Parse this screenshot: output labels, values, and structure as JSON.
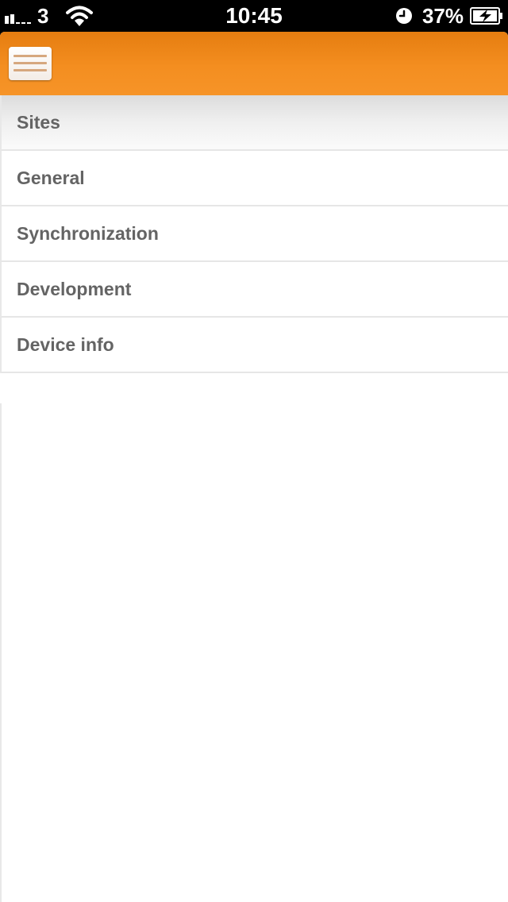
{
  "status_bar": {
    "carrier": "3",
    "time": "10:45",
    "battery_percent": "37%",
    "signal_icon": "signal-bars-icon",
    "wifi_icon": "wifi-icon",
    "alarm_icon": "alarm-clock-icon",
    "battery_icon": "battery-charging-icon"
  },
  "header": {
    "menu_icon": "hamburger-menu-icon",
    "color": "#f48e20"
  },
  "menu": {
    "items": [
      {
        "label": "Sites",
        "active": true
      },
      {
        "label": "General",
        "active": false
      },
      {
        "label": "Synchronization",
        "active": false
      },
      {
        "label": "Development",
        "active": false
      },
      {
        "label": "Device info",
        "active": false
      }
    ]
  }
}
